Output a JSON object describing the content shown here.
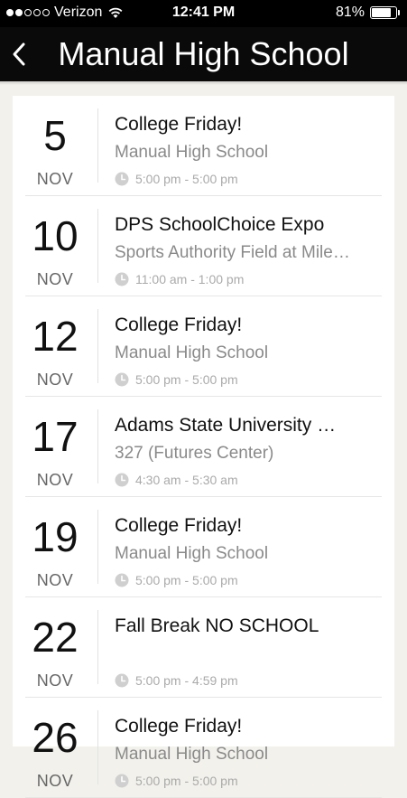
{
  "status": {
    "carrier": "Verizon",
    "time": "12:41 PM",
    "battery": "81%",
    "battery_level": 0.81
  },
  "header": {
    "title": "Manual High School"
  },
  "events": [
    {
      "day": "5",
      "month": "NOV",
      "title": "College Friday!",
      "location": "Manual High School",
      "time": "5:00 pm - 5:00 pm"
    },
    {
      "day": "10",
      "month": "NOV",
      "title": "DPS SchoolChoice Expo",
      "location": "Sports Authority Field at Mile…",
      "time": "11:00 am - 1:00 pm"
    },
    {
      "day": "12",
      "month": "NOV",
      "title": "College Friday!",
      "location": "Manual High School",
      "time": "5:00 pm - 5:00 pm"
    },
    {
      "day": "17",
      "month": "NOV",
      "title": "Adams State University …",
      "location": "327 (Futures Center)",
      "time": "4:30 am - 5:30 am"
    },
    {
      "day": "19",
      "month": "NOV",
      "title": "College Friday!",
      "location": "Manual High School",
      "time": "5:00 pm - 5:00 pm"
    },
    {
      "day": "22",
      "month": "NOV",
      "title": "Fall Break NO SCHOOL",
      "location": "",
      "time": "5:00 pm - 4:59 pm"
    },
    {
      "day": "26",
      "month": "NOV",
      "title": "College Friday!",
      "location": "Manual High School",
      "time": "5:00 pm - 5:00 pm"
    }
  ]
}
